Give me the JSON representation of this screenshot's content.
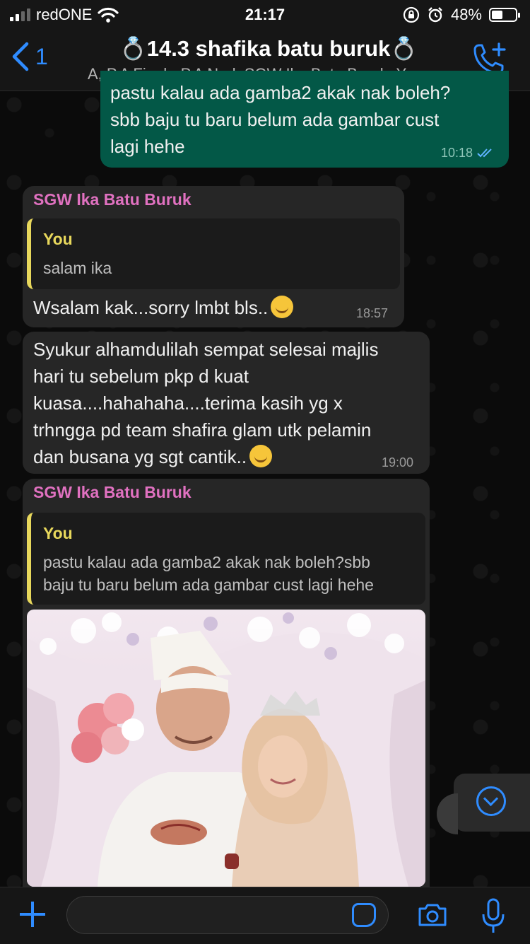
{
  "status_bar": {
    "carrier": "redONE",
    "time": "21:17",
    "battery_percent": "48%",
    "battery_level": 0.48,
    "icons": [
      "signal-icon",
      "wifi-icon",
      "orientation-lock-icon",
      "alarm-icon",
      "battery-icon"
    ]
  },
  "header": {
    "back_count": "1",
    "title": "💍14.3 shafika batu buruk💍",
    "subtitle": "A, P.A Fiqah, P.A Nad, SGW Ika Batu Buruk, Y...",
    "call_icon": "add-call-icon"
  },
  "messages": [
    {
      "type": "outgoing",
      "text_lines": [
        "pastu kalau ada gamba2 akak nak boleh?",
        "sbb baju tu baru belum ada gambar cust",
        "lagi hehe"
      ],
      "time": "10:18",
      "status": "read"
    },
    {
      "type": "incoming",
      "sender": "SGW Ika Batu Buruk",
      "quote_author": "You",
      "quote_text": "salam ika",
      "text": "Wsalam kak...sorry lmbt bls..",
      "emoji": "sweat-smile-emoji",
      "time": "18:57"
    },
    {
      "type": "incoming",
      "text_lines": [
        "Syukur alhamdulilah sempat selesai majlis",
        "hari tu sebelum pkp d kuat",
        "kuasa....hahahaha....terima kasih yg x",
        "trhngga pd  team shafira glam utk pelamin",
        "dan busana yg sgt cantik.."
      ],
      "emoji": "smile-emoji",
      "time": "19:00"
    },
    {
      "type": "incoming",
      "sender": "SGW Ika Batu Buruk",
      "quote_author": "You",
      "quote_text_lines": [
        "pastu kalau ada gamba2 akak nak boleh?sbb",
        "baju tu baru belum ada gambar cust lagi hehe"
      ],
      "media": "wedding-photo"
    }
  ],
  "input_bar": {
    "placeholder": "",
    "icons": [
      "plus-icon",
      "sticker-icon",
      "camera-icon",
      "microphone-icon"
    ]
  },
  "colors": {
    "accent": "#2f8cff",
    "outgoing_bubble": "#035847",
    "incoming_bubble": "#262626",
    "sender_name": "#e071c0",
    "quote_author": "#e8d85c"
  }
}
